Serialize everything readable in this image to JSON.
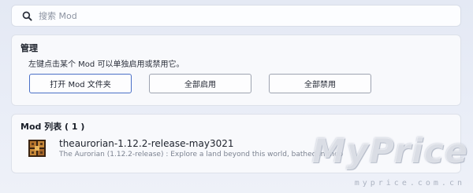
{
  "search": {
    "placeholder": "搜索 Mod",
    "value": ""
  },
  "manage": {
    "title": "管理",
    "description": "左键点击某个 Mod 可以单独启用或禁用它。",
    "buttons": {
      "open_folder": "打开 Mod 文件夹",
      "enable_all": "全部启用",
      "disable_all": "全部禁用"
    }
  },
  "mod_list": {
    "title": "Mod 列表 ( 1 )",
    "items": [
      {
        "name": "theaurorian-1.12.2-release-may3021",
        "description": "The Aurorian (1.12.2-release) : Explore a land beyond this world, bathed in moo",
        "icon": "mod-block-icon"
      }
    ]
  },
  "watermark": {
    "logo": "MyPrice",
    "url": "myprice.com.cn"
  },
  "colors": {
    "background": "#e6ebf5",
    "panel": "#f8f9fc",
    "primary_border": "#4a6fc7",
    "button_border": "#9da3b0"
  }
}
